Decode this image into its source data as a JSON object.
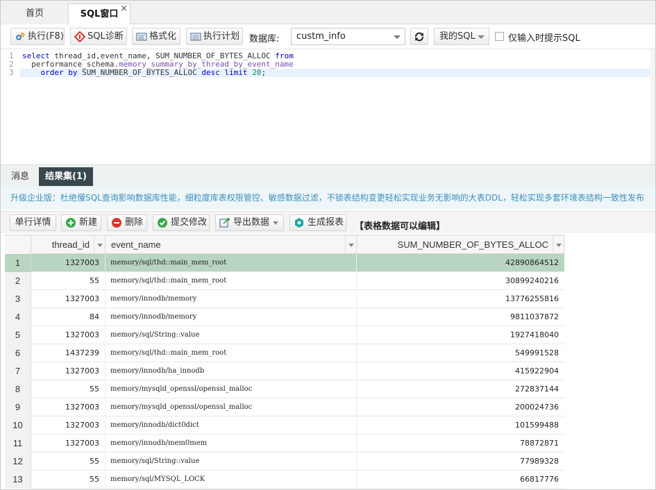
{
  "tabs": {
    "home": "首页",
    "sql": "SQL窗口",
    "close": "×"
  },
  "toolbar": {
    "execute": "执行(F8)",
    "diagnose": "SQL诊断",
    "format": "格式化",
    "plan": "执行计划",
    "db_label": "数据库:",
    "db_value": "custm_info",
    "my_sql": "我的SQL",
    "hint_only": "仅输入时提示SQL"
  },
  "editor": {
    "line_numbers": [
      "1",
      "2",
      "3"
    ],
    "lines": [
      "select thread_id,event_name, SUM_NUMBER_OF_BYTES_ALLOC from",
      "  performance_schema.memory_summary_by_thread_by_event_name",
      "    order by SUM_NUMBER_OF_BYTES_ALLOC desc limit 20;"
    ]
  },
  "result_tabs": {
    "messages": "消息",
    "resultset": "结果集(1)"
  },
  "promo": "升级企业版：杜绝慢SQL查询影响数据库性能，细粒度库表权限管控、敏感数据过滤，不锁表结构变更轻松实现业务无影响的大表DDL，轻松实现多套环境表结构一致性发布",
  "result_toolbar": {
    "row_detail": "单行详情",
    "new": "新建",
    "delete": "删除",
    "submit": "提交修改",
    "export": "导出数据",
    "report": "生成报表",
    "note": "【表格数据可以编辑】"
  },
  "grid": {
    "columns": [
      "thread_id",
      "event_name",
      "SUM_NUMBER_OF_BYTES_ALLOC"
    ],
    "rows": [
      {
        "n": "1",
        "thread_id": "1327003",
        "event_name": "memory/sql/thd::main_mem_root",
        "bytes": "42890864512"
      },
      {
        "n": "2",
        "thread_id": "55",
        "event_name": "memory/sql/thd::main_mem_root",
        "bytes": "30899240216"
      },
      {
        "n": "3",
        "thread_id": "1327003",
        "event_name": "memory/innodb/memory",
        "bytes": "13776255816"
      },
      {
        "n": "4",
        "thread_id": "84",
        "event_name": "memory/innodb/memory",
        "bytes": "9811037872"
      },
      {
        "n": "5",
        "thread_id": "1327003",
        "event_name": "memory/sql/String::value",
        "bytes": "1927418040"
      },
      {
        "n": "6",
        "thread_id": "1437239",
        "event_name": "memory/sql/thd::main_mem_root",
        "bytes": "549991528"
      },
      {
        "n": "7",
        "thread_id": "1327003",
        "event_name": "memory/innodb/ha_innodb",
        "bytes": "415922904"
      },
      {
        "n": "8",
        "thread_id": "55",
        "event_name": "memory/mysqld_openssl/openssl_malloc",
        "bytes": "272837144"
      },
      {
        "n": "9",
        "thread_id": "1327003",
        "event_name": "memory/mysqld_openssl/openssl_malloc",
        "bytes": "200024736"
      },
      {
        "n": "10",
        "thread_id": "1327003",
        "event_name": "memory/innodb/dict0dict",
        "bytes": "101599488"
      },
      {
        "n": "11",
        "thread_id": "1327003",
        "event_name": "memory/innodb/mem0mem",
        "bytes": "78872871"
      },
      {
        "n": "12",
        "thread_id": "55",
        "event_name": "memory/sql/String::value",
        "bytes": "77989328"
      },
      {
        "n": "13",
        "thread_id": "55",
        "event_name": "memory/sql/MYSQL_LOCK",
        "bytes": "66817776"
      }
    ]
  },
  "colors": {
    "selected_row": "#b7d5c0",
    "active_result_tab": "#39474f",
    "promo_text": "#3f8fbf",
    "sql_keyword": "#0000cc"
  }
}
